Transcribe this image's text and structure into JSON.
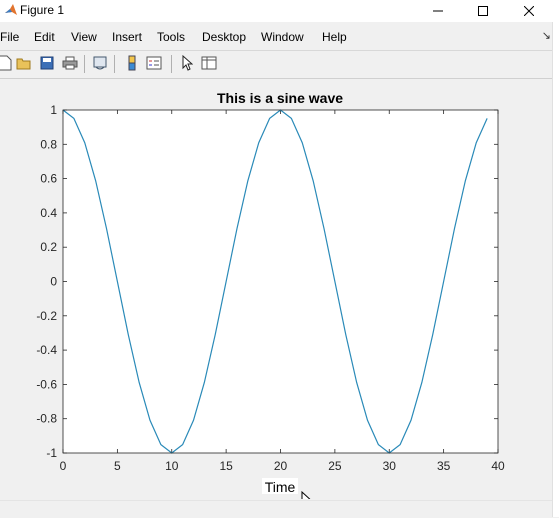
{
  "window": {
    "title": "Figure 1",
    "minimize_symbol": "—",
    "maximize_symbol": "☐",
    "close_symbol": "✕"
  },
  "menu": {
    "items": [
      "File",
      "Edit",
      "View",
      "Insert",
      "Tools",
      "Desktop",
      "Window",
      "Help"
    ],
    "corner_symbol": "↘"
  },
  "toolbar": {
    "buttons": [
      "new-figure-icon",
      "open-file-icon",
      "save-icon",
      "print-icon",
      "link-plot-icon",
      "colorbar-icon",
      "legend-icon",
      "pointer-icon",
      "property-inspector-icon"
    ]
  },
  "colors": {
    "line": "#2a8ab8",
    "axes_bg": "#ffffff",
    "figure_bg": "#f0f0f0"
  },
  "chart_data": {
    "type": "line",
    "title": "This is a sine wave",
    "xlabel": "Time",
    "ylabel": "",
    "xlim": [
      0,
      40
    ],
    "ylim": [
      -1,
      1
    ],
    "xticks": [
      0,
      5,
      10,
      15,
      20,
      25,
      30,
      35,
      40
    ],
    "xtick_labels": [
      "0",
      "5",
      "10",
      "15",
      "20",
      "25",
      "30",
      "35",
      "40"
    ],
    "yticks": [
      1,
      0.8,
      0.6,
      0.4,
      0.2,
      0,
      -0.2,
      -0.4,
      -0.6,
      -0.8,
      -1
    ],
    "ytick_labels": [
      "1",
      "0.8",
      "0.6",
      "0.4",
      "0.2",
      "0",
      "-0.2",
      "-0.4",
      "-0.6",
      "-0.8",
      "-1"
    ],
    "grid": false,
    "series": [
      {
        "x": [
          0,
          1,
          2,
          3,
          4,
          5,
          6,
          7,
          8,
          9,
          10,
          11,
          12,
          13,
          14,
          15,
          16,
          17,
          18,
          19,
          20,
          21,
          22,
          23,
          24,
          25,
          26,
          27,
          28,
          29,
          30,
          31,
          32,
          33,
          34,
          35,
          36,
          37,
          38,
          39
        ],
        "values": [
          1,
          0.951,
          0.809,
          0.588,
          0.309,
          0,
          -0.309,
          -0.588,
          -0.809,
          -0.951,
          -1,
          -0.951,
          -0.809,
          -0.588,
          -0.309,
          0,
          0.309,
          0.588,
          0.809,
          0.951,
          1,
          0.951,
          0.809,
          0.588,
          0.309,
          0,
          -0.309,
          -0.588,
          -0.809,
          -0.951,
          -1,
          -0.951,
          -0.809,
          -0.588,
          -0.309,
          0,
          0.309,
          0.588,
          0.809,
          0.951
        ]
      }
    ]
  }
}
